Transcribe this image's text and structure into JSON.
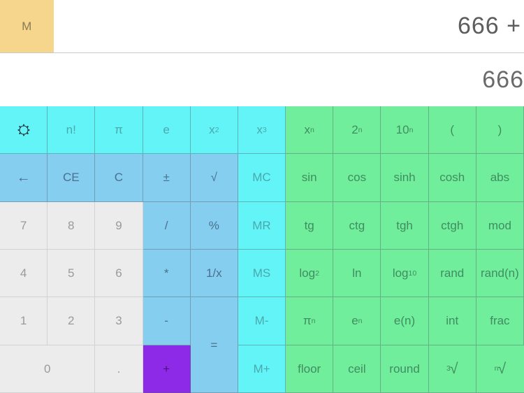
{
  "app": {
    "title": "Calculator"
  },
  "display": {
    "memory_indicator": "M",
    "memory_active": true,
    "memory_color": "#f6d58c",
    "expression": "666 +",
    "value": "666"
  },
  "colors": {
    "numeric_key": "#ececec",
    "cyan_key": "#62f4f7",
    "blue_key": "#85ceef",
    "green_key": "#71ee9b",
    "pressed_key": "#8c2ae8",
    "grid_line": "#5a646e",
    "display_text": "#5d5d5d"
  },
  "keypad": {
    "columns": 11,
    "rows": 6,
    "row1": [
      {
        "name": "settings",
        "label": "",
        "icon": "gear-icon",
        "style": "cyan"
      },
      {
        "name": "factorial",
        "label": "n!",
        "style": "cyan"
      },
      {
        "name": "pi",
        "label": "π",
        "style": "cyan"
      },
      {
        "name": "euler-e",
        "label": "e",
        "style": "cyan"
      },
      {
        "name": "x-squared",
        "label": "x",
        "sup": "2",
        "style": "cyan"
      },
      {
        "name": "x-cubed",
        "label": "x",
        "sup": "3",
        "style": "cyan"
      },
      {
        "name": "x-power-n",
        "label": "x",
        "sup": "n",
        "style": "green"
      },
      {
        "name": "two-power-n",
        "label": "2",
        "sup": "n",
        "style": "green"
      },
      {
        "name": "ten-power-n",
        "label": "10",
        "sup": "n",
        "style": "green"
      },
      {
        "name": "paren-open",
        "label": "(",
        "style": "green"
      },
      {
        "name": "paren-close",
        "label": ")",
        "style": "green"
      }
    ],
    "row2": [
      {
        "name": "backspace",
        "label": "←",
        "style": "blue",
        "big": true
      },
      {
        "name": "clear-entry",
        "label": "CE",
        "style": "blue"
      },
      {
        "name": "clear",
        "label": "C",
        "style": "blue"
      },
      {
        "name": "plus-minus",
        "label": "±",
        "style": "blue"
      },
      {
        "name": "square-root",
        "label": "√",
        "style": "blue"
      },
      {
        "name": "memory-clear",
        "label": "MC",
        "style": "cyan"
      },
      {
        "name": "sin",
        "label": "sin",
        "style": "green"
      },
      {
        "name": "cos",
        "label": "cos",
        "style": "green"
      },
      {
        "name": "sinh",
        "label": "sinh",
        "style": "green"
      },
      {
        "name": "cosh",
        "label": "cosh",
        "style": "green"
      },
      {
        "name": "abs",
        "label": "abs",
        "style": "green"
      }
    ],
    "row3": [
      {
        "name": "digit-7",
        "label": "7",
        "style": "num"
      },
      {
        "name": "digit-8",
        "label": "8",
        "style": "num"
      },
      {
        "name": "digit-9",
        "label": "9",
        "style": "num"
      },
      {
        "name": "divide",
        "label": "/",
        "style": "blue"
      },
      {
        "name": "percent",
        "label": "%",
        "style": "blue"
      },
      {
        "name": "memory-recall",
        "label": "MR",
        "style": "cyan"
      },
      {
        "name": "tangent",
        "label": "tg",
        "style": "green"
      },
      {
        "name": "cotangent",
        "label": "ctg",
        "style": "green"
      },
      {
        "name": "tangent-h",
        "label": "tgh",
        "style": "green"
      },
      {
        "name": "cotangent-h",
        "label": "ctgh",
        "style": "green"
      },
      {
        "name": "modulo",
        "label": "mod",
        "style": "green"
      }
    ],
    "row4": [
      {
        "name": "digit-4",
        "label": "4",
        "style": "num"
      },
      {
        "name": "digit-5",
        "label": "5",
        "style": "num"
      },
      {
        "name": "digit-6",
        "label": "6",
        "style": "num"
      },
      {
        "name": "multiply",
        "label": "*",
        "style": "blue"
      },
      {
        "name": "reciprocal",
        "label": "1/x",
        "style": "blue"
      },
      {
        "name": "memory-store",
        "label": "MS",
        "style": "cyan"
      },
      {
        "name": "log-base-2",
        "label": "log",
        "sub": "2",
        "style": "green"
      },
      {
        "name": "natural-log",
        "label": "ln",
        "style": "green"
      },
      {
        "name": "log-base-10",
        "label": "log",
        "sub": "10",
        "style": "green"
      },
      {
        "name": "random",
        "label": "rand",
        "style": "green"
      },
      {
        "name": "random-n",
        "label": "rand(n)",
        "style": "green"
      }
    ],
    "row5": [
      {
        "name": "digit-1",
        "label": "1",
        "style": "num"
      },
      {
        "name": "digit-2",
        "label": "2",
        "style": "num"
      },
      {
        "name": "digit-3",
        "label": "3",
        "style": "num"
      },
      {
        "name": "subtract",
        "label": "-",
        "style": "blue"
      },
      {
        "name": "equals",
        "label": "=",
        "style": "blue",
        "span_rows": 2
      },
      {
        "name": "memory-subtract",
        "label": "M-",
        "style": "cyan"
      },
      {
        "name": "pi-power-n",
        "label": "π",
        "sup": "n",
        "style": "green"
      },
      {
        "name": "e-power-n",
        "label": "e",
        "sup": "n",
        "style": "green"
      },
      {
        "name": "e-of-n",
        "label": "e(n)",
        "style": "green"
      },
      {
        "name": "integer-part",
        "label": "int",
        "style": "green"
      },
      {
        "name": "fractional-part",
        "label": "frac",
        "style": "green"
      }
    ],
    "row6": [
      {
        "name": "digit-0",
        "label": "0",
        "style": "num",
        "span_cols": 2
      },
      {
        "name": "decimal-point",
        "label": ".",
        "style": "num"
      },
      {
        "name": "add",
        "label": "+",
        "style": "purple",
        "pressed": true
      },
      {
        "name": "memory-add",
        "label": "M+",
        "style": "cyan"
      },
      {
        "name": "floor",
        "label": "floor",
        "style": "green"
      },
      {
        "name": "ceil",
        "label": "ceil",
        "style": "green"
      },
      {
        "name": "round",
        "label": "round",
        "style": "green"
      },
      {
        "name": "cube-root",
        "label": "√",
        "pre_sup": "3",
        "style": "green"
      },
      {
        "name": "nth-root",
        "label": "√",
        "pre_sup": "n",
        "style": "green"
      }
    ]
  }
}
